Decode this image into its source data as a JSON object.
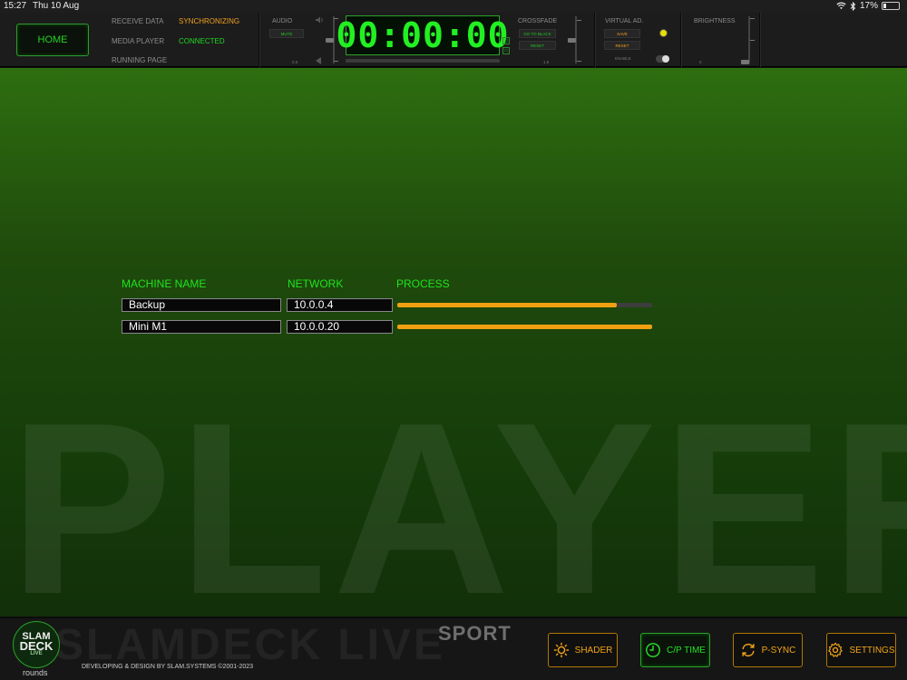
{
  "status_bar": {
    "time": "15:27",
    "date": "Thu 10 Aug",
    "battery": "17%"
  },
  "top_bar": {
    "home_label": "HOME",
    "info": [
      {
        "label": "RECEIVE DATA",
        "value": "SYNCHRONIZING",
        "value_color": "#f0a020"
      },
      {
        "label": "MEDIA PLAYER",
        "value": "CONNECTED",
        "value_color": "#22d822"
      },
      {
        "label": "RUNNING PAGE",
        "value": "",
        "value_color": "#22d822"
      }
    ],
    "audio": {
      "title": "AUDIO",
      "mute_label": "MUTE",
      "level": "0.5"
    },
    "timer": {
      "value": "00:00:00"
    },
    "crossfade": {
      "title": "CROSSFADE",
      "go_to_black_label": "GO TO BLACK",
      "reset_label": "RESET",
      "level": "1.5"
    },
    "virtual_ad": {
      "title": "VIRTUAL AD.",
      "save_label": "SAVE",
      "reset_label": "RESET",
      "enable_label": "ENABLE",
      "led_color": "#e8e000"
    },
    "brightness": {
      "title": "BRIGHTNESS",
      "level": "0"
    }
  },
  "main": {
    "watermark": "PLAYER",
    "columns": [
      "MACHINE NAME",
      "NETWORK",
      "PROCESS"
    ],
    "machines": [
      {
        "name": "Backup",
        "network": "10.0.0.4",
        "progress": 0.86
      },
      {
        "name": "Mini M1",
        "network": "10.0.0.20",
        "progress": 1.0
      }
    ]
  },
  "bottom_bar": {
    "watermark": "SLAMDECK LIVE",
    "sport_label": "SPORT",
    "logo": {
      "line1": "SLAM",
      "line2": "DECK",
      "line3": "LIVE"
    },
    "logo_caption": "rounds",
    "credit": "DEVELOPING & DESIGN BY SLAM.SYSTEMS ©2001-2023",
    "buttons": [
      {
        "label": "SHADER",
        "icon": "sun-icon",
        "active": false
      },
      {
        "label": "C/P TIME",
        "icon": "clock-icon",
        "active": true
      },
      {
        "label": "P-SYNC",
        "icon": "sync-icon",
        "active": false
      },
      {
        "label": "SETTINGS",
        "icon": "gear-icon",
        "active": false
      }
    ],
    "accent_color": "#f2a418",
    "active_color": "#28e028"
  }
}
